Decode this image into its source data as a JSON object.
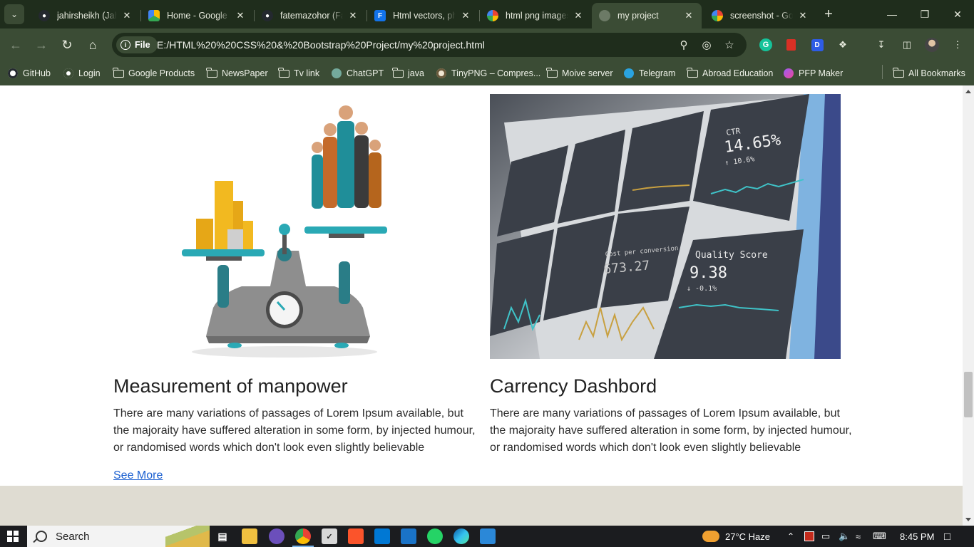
{
  "browser": {
    "tabs": [
      {
        "title": "jahirsheikh (Jahir",
        "favicon": "github-icon",
        "active": false
      },
      {
        "title": "Home - Google Drive",
        "favicon": "google-drive-icon",
        "active": false
      },
      {
        "title": "fatemazohor (Fatema",
        "favicon": "github-icon",
        "active": false
      },
      {
        "title": "Html vectors, photos",
        "favicon": "freepik-icon",
        "active": false
      },
      {
        "title": "html png images",
        "favicon": "google-icon",
        "active": false
      },
      {
        "title": "my project",
        "favicon": "globe-icon",
        "active": true
      },
      {
        "title": "screenshot - Google",
        "favicon": "google-icon",
        "active": false
      }
    ],
    "address": {
      "scheme_label": "File",
      "url": "E:/HTML%20%20CSS%20&%20Bootstrap%20Project/my%20project.html"
    },
    "bookmarks": [
      {
        "label": "GitHub",
        "icon": "github-icon"
      },
      {
        "label": "Login",
        "icon": "login-icon"
      },
      {
        "label": "Google Products",
        "icon": "folder-icon"
      },
      {
        "label": "NewsPaper",
        "icon": "folder-icon"
      },
      {
        "label": "Tv link",
        "icon": "folder-icon"
      },
      {
        "label": "ChatGPT",
        "icon": "chatgpt-icon"
      },
      {
        "label": "java",
        "icon": "folder-icon"
      },
      {
        "label": "TinyPNG – Compres...",
        "icon": "tinypng-icon"
      },
      {
        "label": "Moive server",
        "icon": "folder-icon"
      },
      {
        "label": "Telegram",
        "icon": "telegram-icon"
      },
      {
        "label": "Abroad Education",
        "icon": "folder-icon"
      },
      {
        "label": "PFP Maker",
        "icon": "pfp-maker-icon"
      }
    ],
    "all_bookmarks_label": "All Bookmarks"
  },
  "page": {
    "cards": [
      {
        "image_alt": "scale-people-vs-coins-illustration",
        "title": "Measurement of manpower",
        "text": "There are many variations of passages of Lorem Ipsum available, but the majoraity have suffered alteration in some form, by injected humour, or randomised words which don't look even slightly believable"
      },
      {
        "image_alt": "analytics-dashboard-photo",
        "title": "Carrency Dashbord",
        "text": "There are many variations of passages of Lorem Ipsum available, but the majoraity have suffered alteration in some form, by injected humour, or randomised words which don't look even slightly believable",
        "dashboard": {
          "ctr_label": "CTR",
          "ctr_value": "14.65%",
          "ctr_delta": "↑ 10.6%",
          "conversion_label": "Cost per conversion",
          "conversion_value": "673.27",
          "quality_label": "Quality Score",
          "quality_value": "9.38",
          "quality_delta": "↓ -0.1%"
        }
      }
    ],
    "see_more_label": "See More"
  },
  "taskbar": {
    "search_label": "Search",
    "weather": "27°C  Haze",
    "time": "8:45 PM"
  },
  "colors": {
    "chrome_dark": "#1f2d1c",
    "chrome": "#3b4c35",
    "link": "#1a5fd0",
    "footer_band": "#dfdcd2",
    "teal": "#2aa9b5"
  }
}
